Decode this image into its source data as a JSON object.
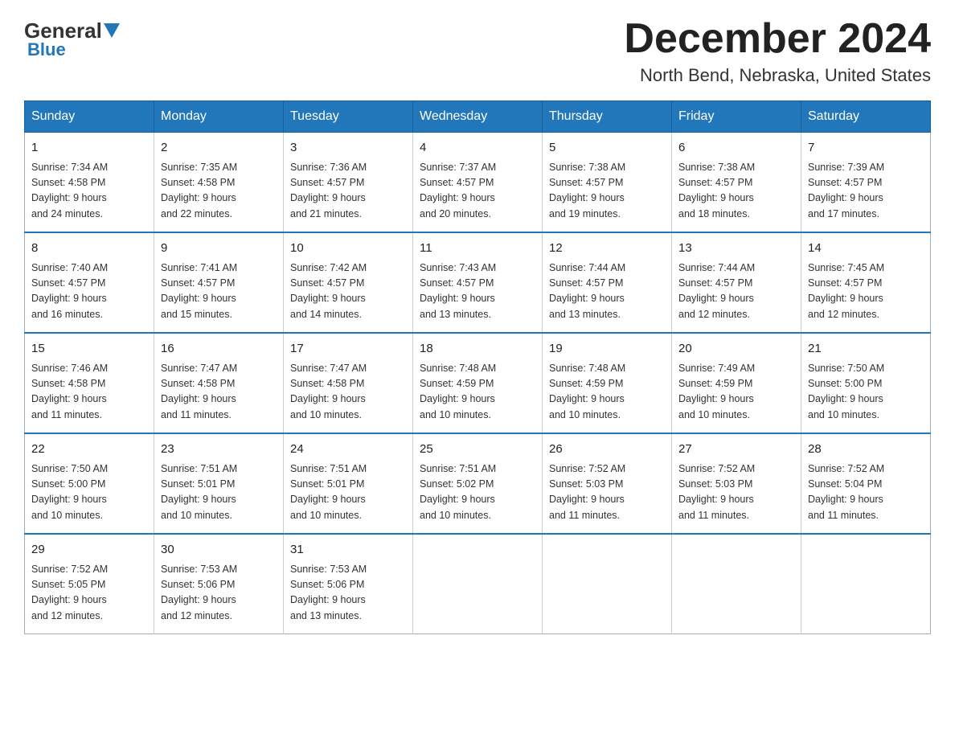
{
  "header": {
    "logo_general": "General",
    "logo_blue": "Blue",
    "month_title": "December 2024",
    "location": "North Bend, Nebraska, United States"
  },
  "days_of_week": [
    "Sunday",
    "Monday",
    "Tuesday",
    "Wednesday",
    "Thursday",
    "Friday",
    "Saturday"
  ],
  "weeks": [
    [
      {
        "day": "1",
        "sunrise": "7:34 AM",
        "sunset": "4:58 PM",
        "daylight": "9 hours and 24 minutes."
      },
      {
        "day": "2",
        "sunrise": "7:35 AM",
        "sunset": "4:58 PM",
        "daylight": "9 hours and 22 minutes."
      },
      {
        "day": "3",
        "sunrise": "7:36 AM",
        "sunset": "4:57 PM",
        "daylight": "9 hours and 21 minutes."
      },
      {
        "day": "4",
        "sunrise": "7:37 AM",
        "sunset": "4:57 PM",
        "daylight": "9 hours and 20 minutes."
      },
      {
        "day": "5",
        "sunrise": "7:38 AM",
        "sunset": "4:57 PM",
        "daylight": "9 hours and 19 minutes."
      },
      {
        "day": "6",
        "sunrise": "7:38 AM",
        "sunset": "4:57 PM",
        "daylight": "9 hours and 18 minutes."
      },
      {
        "day": "7",
        "sunrise": "7:39 AM",
        "sunset": "4:57 PM",
        "daylight": "9 hours and 17 minutes."
      }
    ],
    [
      {
        "day": "8",
        "sunrise": "7:40 AM",
        "sunset": "4:57 PM",
        "daylight": "9 hours and 16 minutes."
      },
      {
        "day": "9",
        "sunrise": "7:41 AM",
        "sunset": "4:57 PM",
        "daylight": "9 hours and 15 minutes."
      },
      {
        "day": "10",
        "sunrise": "7:42 AM",
        "sunset": "4:57 PM",
        "daylight": "9 hours and 14 minutes."
      },
      {
        "day": "11",
        "sunrise": "7:43 AM",
        "sunset": "4:57 PM",
        "daylight": "9 hours and 13 minutes."
      },
      {
        "day": "12",
        "sunrise": "7:44 AM",
        "sunset": "4:57 PM",
        "daylight": "9 hours and 13 minutes."
      },
      {
        "day": "13",
        "sunrise": "7:44 AM",
        "sunset": "4:57 PM",
        "daylight": "9 hours and 12 minutes."
      },
      {
        "day": "14",
        "sunrise": "7:45 AM",
        "sunset": "4:57 PM",
        "daylight": "9 hours and 12 minutes."
      }
    ],
    [
      {
        "day": "15",
        "sunrise": "7:46 AM",
        "sunset": "4:58 PM",
        "daylight": "9 hours and 11 minutes."
      },
      {
        "day": "16",
        "sunrise": "7:47 AM",
        "sunset": "4:58 PM",
        "daylight": "9 hours and 11 minutes."
      },
      {
        "day": "17",
        "sunrise": "7:47 AM",
        "sunset": "4:58 PM",
        "daylight": "9 hours and 10 minutes."
      },
      {
        "day": "18",
        "sunrise": "7:48 AM",
        "sunset": "4:59 PM",
        "daylight": "9 hours and 10 minutes."
      },
      {
        "day": "19",
        "sunrise": "7:48 AM",
        "sunset": "4:59 PM",
        "daylight": "9 hours and 10 minutes."
      },
      {
        "day": "20",
        "sunrise": "7:49 AM",
        "sunset": "4:59 PM",
        "daylight": "9 hours and 10 minutes."
      },
      {
        "day": "21",
        "sunrise": "7:50 AM",
        "sunset": "5:00 PM",
        "daylight": "9 hours and 10 minutes."
      }
    ],
    [
      {
        "day": "22",
        "sunrise": "7:50 AM",
        "sunset": "5:00 PM",
        "daylight": "9 hours and 10 minutes."
      },
      {
        "day": "23",
        "sunrise": "7:51 AM",
        "sunset": "5:01 PM",
        "daylight": "9 hours and 10 minutes."
      },
      {
        "day": "24",
        "sunrise": "7:51 AM",
        "sunset": "5:01 PM",
        "daylight": "9 hours and 10 minutes."
      },
      {
        "day": "25",
        "sunrise": "7:51 AM",
        "sunset": "5:02 PM",
        "daylight": "9 hours and 10 minutes."
      },
      {
        "day": "26",
        "sunrise": "7:52 AM",
        "sunset": "5:03 PM",
        "daylight": "9 hours and 11 minutes."
      },
      {
        "day": "27",
        "sunrise": "7:52 AM",
        "sunset": "5:03 PM",
        "daylight": "9 hours and 11 minutes."
      },
      {
        "day": "28",
        "sunrise": "7:52 AM",
        "sunset": "5:04 PM",
        "daylight": "9 hours and 11 minutes."
      }
    ],
    [
      {
        "day": "29",
        "sunrise": "7:52 AM",
        "sunset": "5:05 PM",
        "daylight": "9 hours and 12 minutes."
      },
      {
        "day": "30",
        "sunrise": "7:53 AM",
        "sunset": "5:06 PM",
        "daylight": "9 hours and 12 minutes."
      },
      {
        "day": "31",
        "sunrise": "7:53 AM",
        "sunset": "5:06 PM",
        "daylight": "9 hours and 13 minutes."
      },
      null,
      null,
      null,
      null
    ]
  ],
  "labels": {
    "sunrise": "Sunrise:",
    "sunset": "Sunset:",
    "daylight": "Daylight:"
  }
}
